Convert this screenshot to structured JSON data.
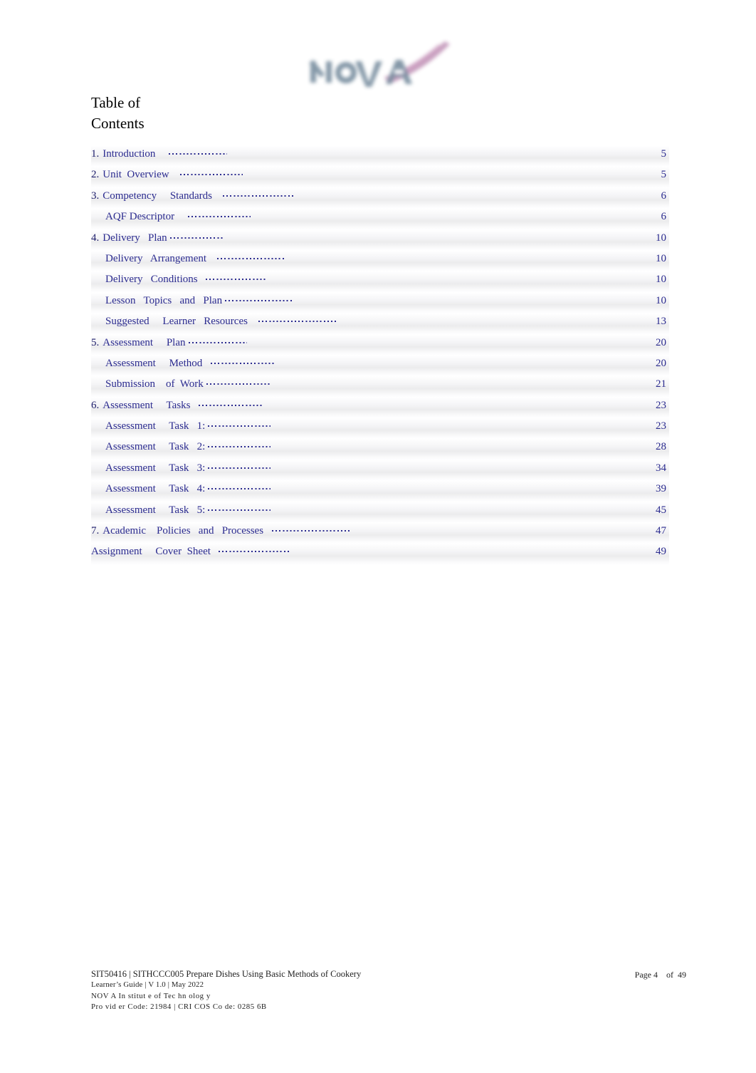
{
  "document": {
    "heading": "Table of\nContents",
    "logo_alt": "NOVA Institute of Technology logo",
    "logo_text": "NOVA",
    "logo_word_color": "#6b8095",
    "logo_swoosh_color": "#b06b9a"
  },
  "toc": {
    "entries": [
      {
        "number": "1.",
        "label": "Introduction",
        "gap": "    ",
        "page": "5",
        "level": 1,
        "leader_width": 82
      },
      {
        "number": "2.",
        "label": "Unit  Overview",
        "gap": "   ",
        "page": "5",
        "level": 1,
        "leader_width": 88
      },
      {
        "number": "3.",
        "label": "Competency     Standards",
        "gap": "   ",
        "page": "6",
        "level": 1,
        "leader_width": 100
      },
      {
        "number": "",
        "label": "AQF Descriptor",
        "gap": "    ",
        "page": "6",
        "level": 2,
        "leader_width": 88
      },
      {
        "number": "4.",
        "label": "Delivery   Plan",
        "gap": "",
        "page": "10",
        "level": 1,
        "leader_width": 76
      },
      {
        "number": "",
        "label": "Delivery   Arrangement",
        "gap": "   ",
        "page": "10",
        "level": 2,
        "leader_width": 96
      },
      {
        "number": "",
        "label": "Delivery   Conditions",
        "gap": "  ",
        "page": "10",
        "level": 2,
        "leader_width": 86
      },
      {
        "number": "",
        "label": "Lesson   Topics   and   Plan",
        "gap": "",
        "page": "10",
        "level": 2,
        "leader_width": 96
      },
      {
        "number": "",
        "label": "Suggested     Learner   Resources",
        "gap": "   ",
        "page": "13",
        "level": 2,
        "leader_width": 110
      },
      {
        "number": "5.",
        "label": "Assessment     Plan",
        "gap": "",
        "page": "20",
        "level": 1,
        "leader_width": 82
      },
      {
        "number": "",
        "label": "Assessment     Method",
        "gap": "  ",
        "page": "20",
        "level": 2,
        "leader_width": 92
      },
      {
        "number": "",
        "label": "Submission    of  Work",
        "gap": "",
        "page": "21",
        "level": 2,
        "leader_width": 92
      },
      {
        "number": "6.",
        "label": "Assessment     Tasks",
        "gap": "  ",
        "page": "23",
        "level": 1,
        "leader_width": 90
      },
      {
        "number": "",
        "label": "Assessment     Task   1:",
        "gap": "",
        "page": "23",
        "level": 2,
        "leader_width": 88
      },
      {
        "number": "",
        "label": "Assessment     Task   2:",
        "gap": "",
        "page": "28",
        "level": 2,
        "leader_width": 88
      },
      {
        "number": "",
        "label": "Assessment     Task   3:",
        "gap": "",
        "page": "34",
        "level": 2,
        "leader_width": 88
      },
      {
        "number": "",
        "label": "Assessment     Task   4:",
        "gap": "",
        "page": "39",
        "level": 2,
        "leader_width": 88
      },
      {
        "number": "",
        "label": "Assessment     Task   5:",
        "gap": "",
        "page": "45",
        "level": 2,
        "leader_width": 88
      },
      {
        "number": "7.",
        "label": "Academic    Policies   and   Processes",
        "gap": "  ",
        "page": "47",
        "level": 1,
        "leader_width": 112
      },
      {
        "number": "",
        "label": "Assignment     Cover  Sheet",
        "gap": "  ",
        "page": "49",
        "level": 1,
        "leader_width": 100
      }
    ]
  },
  "footer": {
    "line1": "SIT50416 | SITHCCC005  Prepare  Dishes  Using  Basic  Methods  of Cookery",
    "line2": "Learner’s Guide | V 1.0 | May 2022",
    "line3": "NOV A In stitut e   of Tec  hn  olog y",
    "line4": "Pro vid er   Code:    21984    |   CRI COS  Co de:   0285  6B",
    "page_label": "Page 4    of  49"
  }
}
